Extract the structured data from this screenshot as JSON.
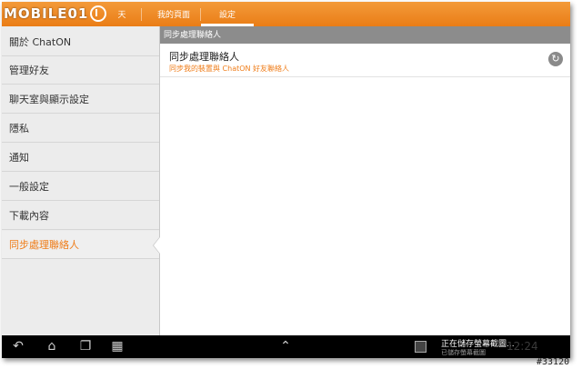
{
  "header": {
    "logo_text": "MOBILE01",
    "tabs": [
      {
        "label": "天"
      },
      {
        "label": "我的頁面"
      },
      {
        "label": "設定"
      }
    ]
  },
  "sidebar": {
    "items": [
      {
        "label": "關於 ChatON"
      },
      {
        "label": "管理好友"
      },
      {
        "label": "聊天室與顯示設定"
      },
      {
        "label": "隱私"
      },
      {
        "label": "通知"
      },
      {
        "label": "一般設定"
      },
      {
        "label": "下載內容"
      },
      {
        "label": "同步處理聯絡人"
      }
    ],
    "active_index": 7
  },
  "main": {
    "section_title": "同步處理聯絡人",
    "setting": {
      "title": "同步處理聯絡人",
      "description": "同步我的裝置與 ChatON 好友聯絡人",
      "icon": "sync-icon"
    }
  },
  "navbar": {
    "icons": [
      "back-icon",
      "home-icon",
      "recent-apps-icon",
      "screenshot-icon",
      "expand-up-icon"
    ],
    "notification_title": "正在儲存螢幕截圖...",
    "notification_sub": "已儲存螢幕截圖",
    "clock": "12:24"
  },
  "watermark": "#33120",
  "colors": {
    "accent": "#ef7d1a",
    "tabbar": "#ea7d16",
    "navbar": "#000000"
  }
}
